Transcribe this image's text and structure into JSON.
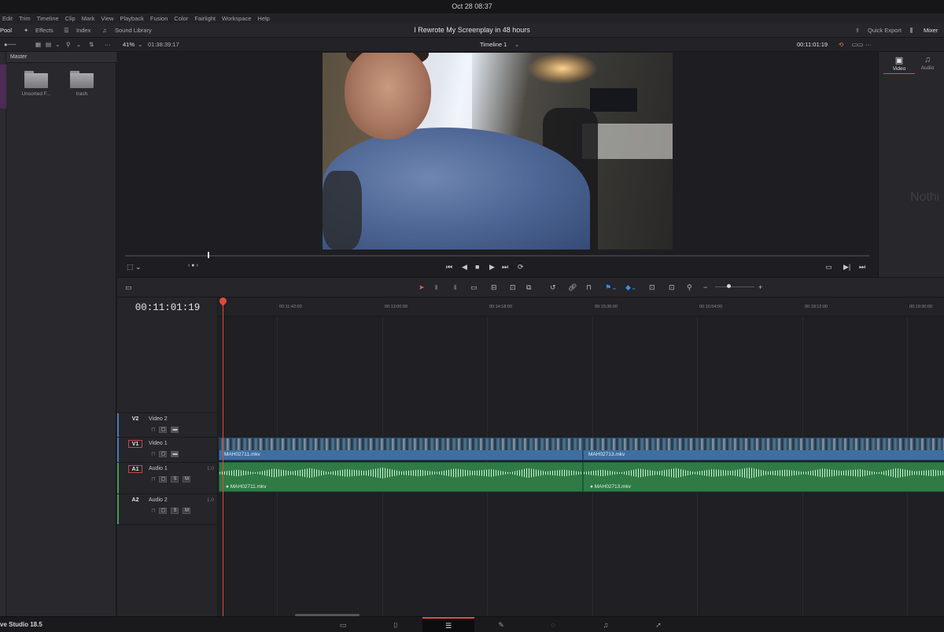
{
  "os": {
    "clock": "Oct 28  08:37"
  },
  "menu": [
    "Edit",
    "Trim",
    "Timeline",
    "Clip",
    "Mark",
    "View",
    "Playback",
    "Fusion",
    "Color",
    "Fairlight",
    "Workspace",
    "Help"
  ],
  "toolbar": {
    "pool": "Pool",
    "effects": "Effects",
    "index": "Index",
    "sound_library": "Sound Library",
    "project_title": "I Rewrote My Screenplay in 48 hours",
    "quick_export": "Quick Export",
    "mixer": "Mixer"
  },
  "viewer_bar": {
    "zoom": "41%",
    "source_timecode": "01:38:39:17",
    "timeline_name": "Timeline 1",
    "record_timecode": "00:11:01:19"
  },
  "media_pool": {
    "header": "Master",
    "folders": [
      {
        "name": "Unsorted F...",
        "icon": "folder-icon"
      },
      {
        "name": "trash",
        "icon": "folder-icon"
      }
    ]
  },
  "inspector": {
    "tabs": [
      {
        "label": "Video",
        "icon": "film-icon",
        "active": true
      },
      {
        "label": "Audio",
        "icon": "music-note-icon",
        "active": false
      }
    ],
    "empty_text": "Nothi"
  },
  "timeline": {
    "timecode": "00:11:01:19",
    "ruler": [
      "00:11:42:00",
      "00:13:00:00",
      "00:14:18:00",
      "00:15:36:00",
      "00:16:54:00",
      "00:18:12:00",
      "00:19:30:00"
    ],
    "tracks": [
      {
        "id": "V2",
        "name": "Video 2",
        "boxed": false,
        "color": "#4a7ab8"
      },
      {
        "id": "V1",
        "name": "Video 1",
        "boxed": true,
        "color": "#4a7ab8"
      },
      {
        "id": "A1",
        "name": "Audio 1",
        "num": "1.0",
        "boxed": true,
        "color": "#3f9a5a"
      },
      {
        "id": "A2",
        "name": "Audio 2",
        "num": "1.0",
        "boxed": false,
        "color": "#3f9a5a"
      }
    ],
    "video_clips": [
      "MAH02711.mkv",
      "MAH02713.mkv"
    ],
    "audio_clips": [
      "MAH02711.mkv",
      "MAH02713.mkv"
    ],
    "audio_clip_prefix": "●"
  },
  "pagebar": {
    "app_name": "ve Studio 18.5",
    "pages": [
      {
        "icon": "media-icon",
        "glyph": "▭",
        "active": false
      },
      {
        "icon": "cut-icon",
        "glyph": "⌷",
        "active": false
      },
      {
        "icon": "edit-icon",
        "glyph": "☰",
        "active": true
      },
      {
        "icon": "fusion-icon",
        "glyph": "✎",
        "active": false
      },
      {
        "icon": "color-icon",
        "glyph": "◌",
        "active": false
      },
      {
        "icon": "fairlight-icon",
        "glyph": "♫",
        "active": false
      },
      {
        "icon": "deliver-icon",
        "glyph": "➚",
        "active": false
      }
    ]
  },
  "accent_colors": {
    "playhead": "#e04a3a",
    "video_clip": "#3d6fa0",
    "audio_clip": "#2f7a45"
  }
}
